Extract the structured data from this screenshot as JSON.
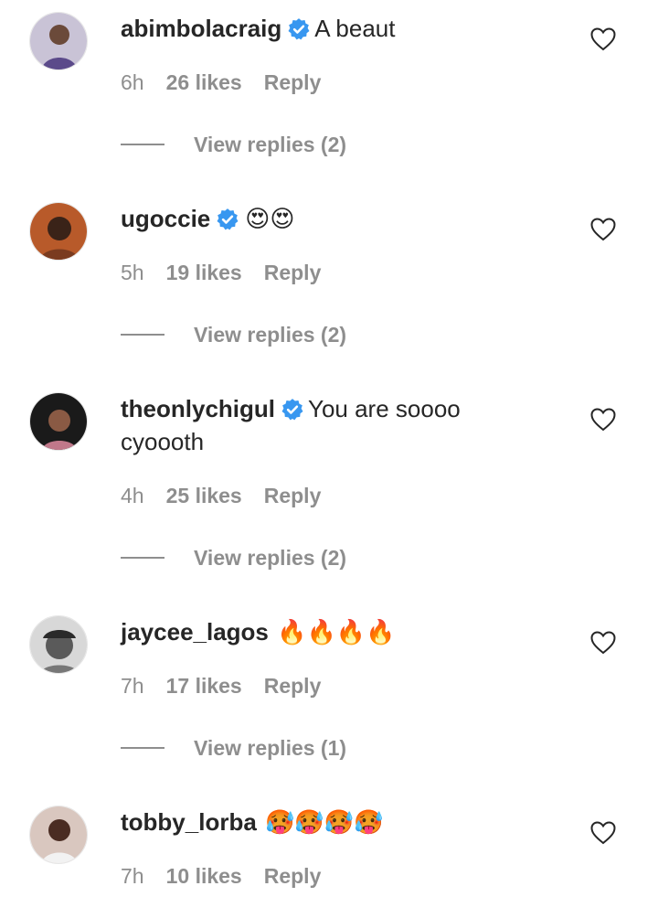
{
  "colors": {
    "text": "#262626",
    "muted": "#8e8e8e",
    "verified": "#3897f0"
  },
  "comments": [
    {
      "username": "abimbolacraig",
      "verified": true,
      "message": "A beaut",
      "emoji": "",
      "time": "6h",
      "likes": "26 likes",
      "reply": "Reply",
      "view_replies": "View replies (2)",
      "avatar_icon": "avatar-woman-blue-dress",
      "like_icon": "heart-outline-icon"
    },
    {
      "username": "ugoccie",
      "verified": true,
      "message": "",
      "emoji": "😍😍",
      "time": "5h",
      "likes": "19 likes",
      "reply": "Reply",
      "view_replies": "View replies (2)",
      "avatar_icon": "avatar-woman-hand-face",
      "like_icon": "heart-outline-icon"
    },
    {
      "username": "theonlychigul",
      "verified": true,
      "message": "You are soooo cyoooth",
      "emoji": "",
      "time": "4h",
      "likes": "25 likes",
      "reply": "Reply",
      "view_replies": "View replies (2)",
      "avatar_icon": "avatar-woman-dark-bg",
      "like_icon": "heart-outline-icon"
    },
    {
      "username": "jaycee_lagos",
      "verified": false,
      "message": "",
      "emoji": "🔥🔥🔥🔥",
      "time": "7h",
      "likes": "17 likes",
      "reply": "Reply",
      "view_replies": "View replies (1)",
      "avatar_icon": "avatar-man-bw-cap",
      "like_icon": "heart-outline-icon"
    },
    {
      "username": "tobby_lorba",
      "verified": false,
      "message": "",
      "emoji": "🥵🥵🥵🥵",
      "time": "7h",
      "likes": "10 likes",
      "reply": "Reply",
      "view_replies": "",
      "avatar_icon": "avatar-woman-white-top",
      "like_icon": "heart-outline-icon"
    }
  ]
}
